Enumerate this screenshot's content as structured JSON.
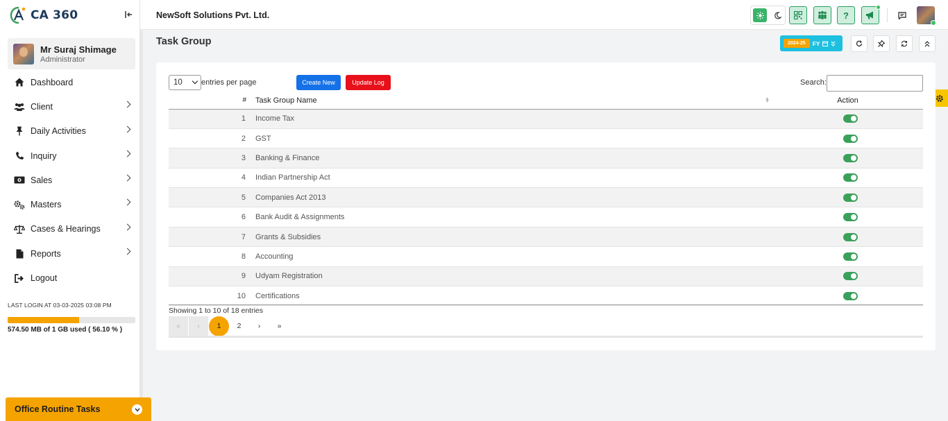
{
  "app": {
    "logo_text": "CA 360",
    "company": "NewSoft Solutions Pvt. Ltd."
  },
  "user": {
    "name": "Mr Suraj Shimage",
    "role": "Administrator"
  },
  "sidebar": {
    "items": [
      {
        "label": "Dashboard",
        "icon": "home-icon",
        "has_children": false
      },
      {
        "label": "Client",
        "icon": "users-icon",
        "has_children": true
      },
      {
        "label": "Daily Activities",
        "icon": "pin-icon",
        "has_children": true
      },
      {
        "label": "Inquiry",
        "icon": "phone-icon",
        "has_children": true
      },
      {
        "label": "Sales",
        "icon": "money-icon",
        "has_children": true
      },
      {
        "label": "Masters",
        "icon": "cogs-icon",
        "has_children": true
      },
      {
        "label": "Cases & Hearings",
        "icon": "scale-icon",
        "has_children": true
      },
      {
        "label": "Reports",
        "icon": "document-icon",
        "has_children": true
      },
      {
        "label": "Logout",
        "icon": "logout-icon",
        "has_children": false
      }
    ],
    "last_login": "LAST LOGIN AT 03-03-2025 03:08 PM",
    "storage_text": "574.50 MB of 1 GB used ( 56.10 % )",
    "storage_percent": 56.1,
    "routine_label": "Office Routine Tasks"
  },
  "page": {
    "title": "Task Group",
    "fy_year": "2024-25",
    "fy_label": "FY"
  },
  "table_controls": {
    "entries_value": "10",
    "entries_label": "entries per page",
    "create_label": "Create New",
    "update_label": "Update Log",
    "search_label": "Search:",
    "search_value": ""
  },
  "table": {
    "headers": {
      "num": "#",
      "name": "Task Group Name",
      "action": "Action"
    },
    "rows": [
      {
        "num": "1",
        "name": "Income Tax",
        "active": true
      },
      {
        "num": "2",
        "name": "GST",
        "active": true
      },
      {
        "num": "3",
        "name": "Banking & Finance",
        "active": true
      },
      {
        "num": "4",
        "name": "Indian Partnership Act",
        "active": true
      },
      {
        "num": "5",
        "name": "Companies Act 2013",
        "active": true
      },
      {
        "num": "6",
        "name": "Bank Audit & Assignments",
        "active": true
      },
      {
        "num": "7",
        "name": "Grants & Subsidies",
        "active": true
      },
      {
        "num": "8",
        "name": "Accounting",
        "active": true
      },
      {
        "num": "9",
        "name": "Udyam Registration",
        "active": true
      },
      {
        "num": "10",
        "name": "Certifications",
        "active": true
      }
    ],
    "summary": "Showing 1 to 10 of 18 entries"
  },
  "pagination": {
    "first": "«",
    "prev": "‹",
    "pages": [
      "1",
      "2"
    ],
    "current": "1",
    "next": "›",
    "last": "»"
  },
  "colors": {
    "accent": "#f5a300",
    "primary": "#1571e8",
    "danger": "#e8101a",
    "success": "#3aa05a",
    "fy_badge": "#1ec0e0"
  }
}
